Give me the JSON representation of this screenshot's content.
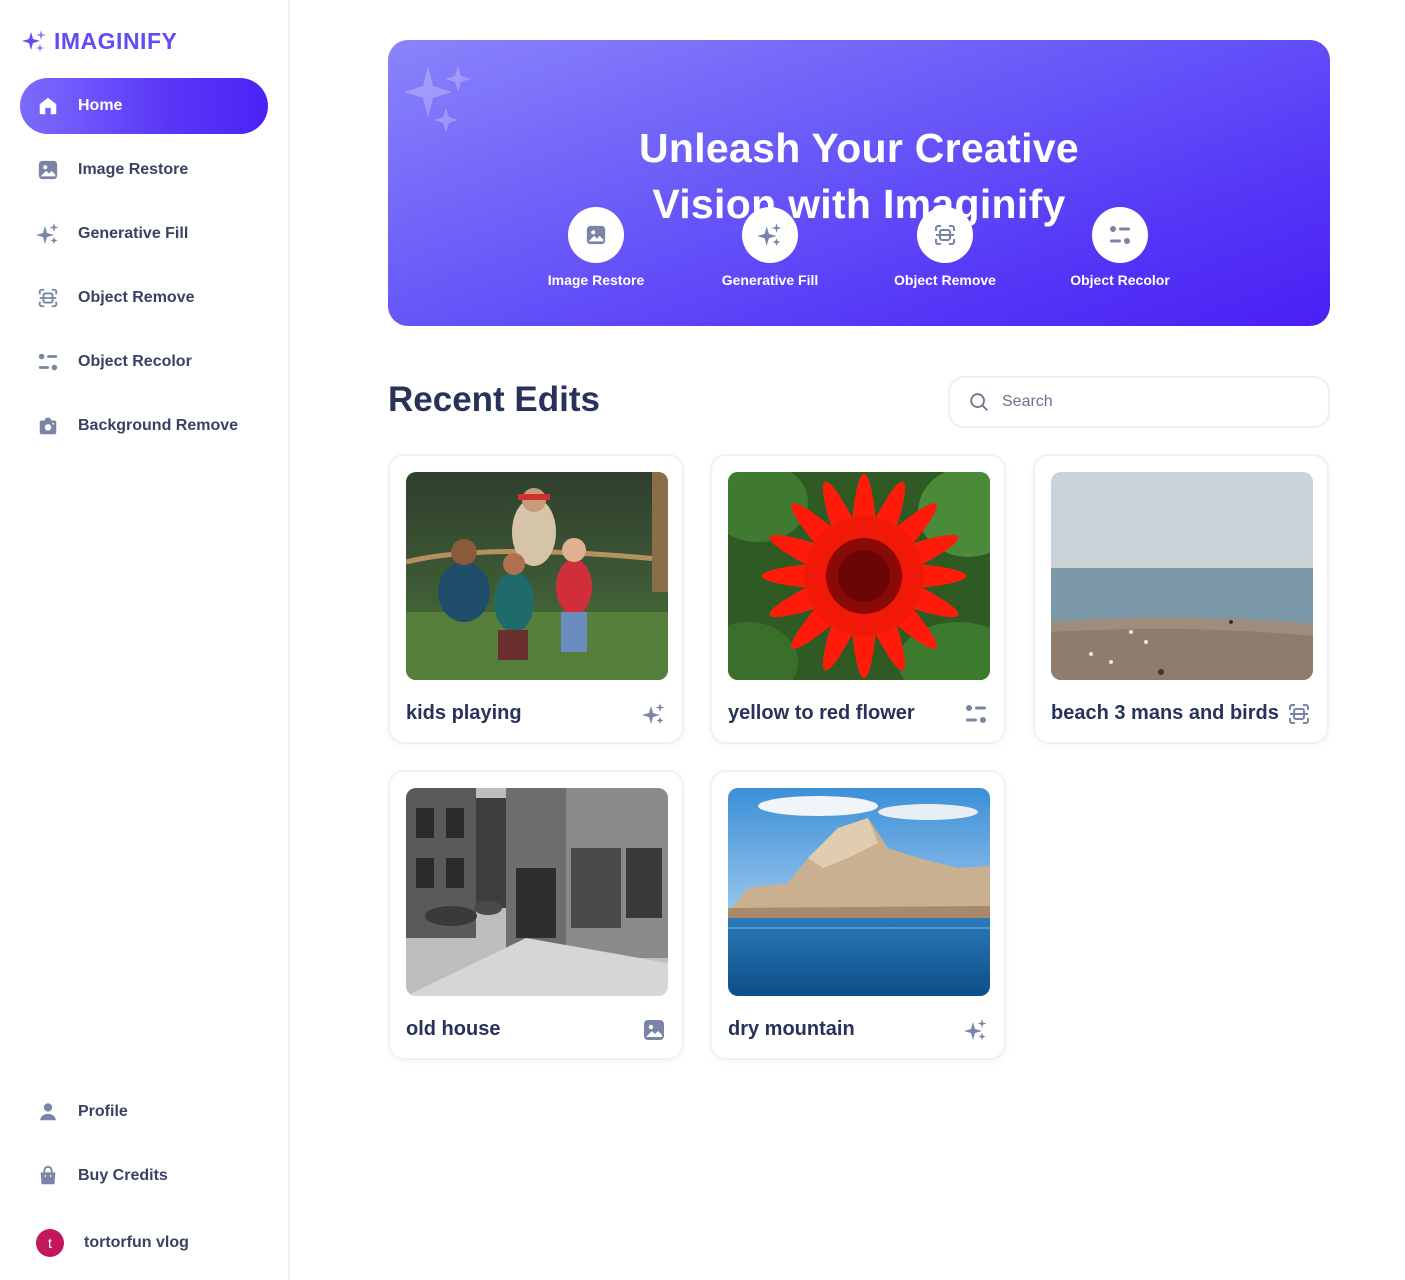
{
  "app": {
    "logo_text": "IMAGINIFY"
  },
  "sidebar": {
    "items": [
      {
        "label": "Home",
        "icon": "home-icon",
        "active": true
      },
      {
        "label": "Image Restore",
        "icon": "image-icon"
      },
      {
        "label": "Generative Fill",
        "icon": "stars-icon"
      },
      {
        "label": "Object Remove",
        "icon": "scan-icon"
      },
      {
        "label": "Object Recolor",
        "icon": "filter-icon"
      },
      {
        "label": "Background Remove",
        "icon": "camera-icon"
      }
    ],
    "bottom_items": [
      {
        "label": "Profile",
        "icon": "user-icon"
      },
      {
        "label": "Buy Credits",
        "icon": "bag-icon"
      }
    ],
    "user": {
      "initial": "t",
      "name": "tortorfun vlog"
    }
  },
  "hero": {
    "title_line1": "Unleash Your Creative",
    "title_line2": "Vision with Imaginify",
    "tools": [
      {
        "label": "Image Restore",
        "icon": "image-icon"
      },
      {
        "label": "Generative Fill",
        "icon": "stars-icon"
      },
      {
        "label": "Object Remove",
        "icon": "scan-icon"
      },
      {
        "label": "Object Recolor",
        "icon": "filter-icon"
      }
    ]
  },
  "recent": {
    "title": "Recent Edits",
    "search_placeholder": "Search",
    "cards": [
      {
        "title": "kids playing",
        "type_icon": "stars-icon"
      },
      {
        "title": "yellow to red flower",
        "type_icon": "filter-icon"
      },
      {
        "title": "beach 3 mans and birds",
        "type_icon": "scan-icon"
      },
      {
        "title": "old house",
        "type_icon": "image-icon"
      },
      {
        "title": "dry mountain",
        "type_icon": "stars-icon"
      }
    ]
  },
  "colors": {
    "brand": "#624cf5",
    "active_nav_start": "#7b6cfb",
    "active_nav_end": "#4a23f5",
    "text_dark": "#28325a",
    "icon_gray": "#7a84a6"
  }
}
